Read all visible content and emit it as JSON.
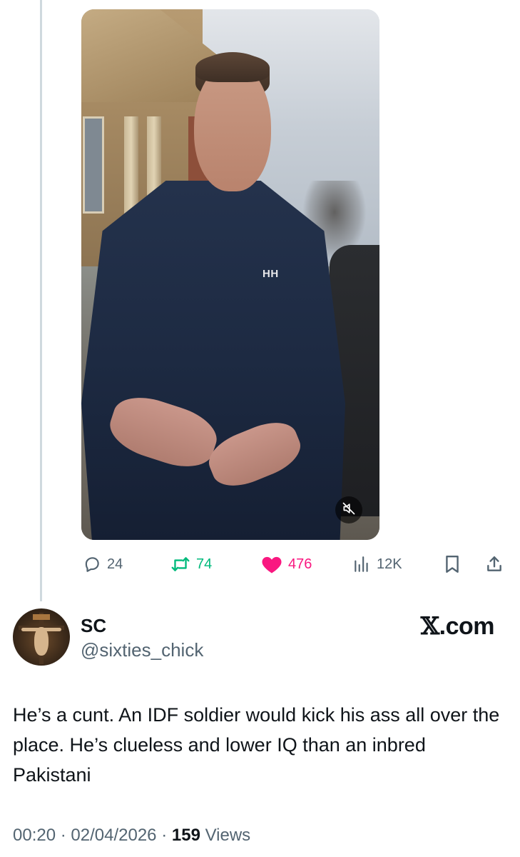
{
  "actions": {
    "replies": "24",
    "reposts": "74",
    "likes": "476",
    "views": "12K"
  },
  "video": {
    "jacket_logo": "HH",
    "muted": true
  },
  "author": {
    "name": "SC",
    "handle": "@sixties_chick"
  },
  "brand": {
    "x_glyph": "𝕏",
    "suffix": ".com"
  },
  "tweet": {
    "text": "He’s a cunt. An IDF soldier would kick his ass all over the place. He’s clueless and lower IQ than an inbred Pakistani"
  },
  "meta": {
    "time": "00:20",
    "date": "02/04/2026",
    "views_count": "159",
    "views_label": "Views",
    "separator": "·"
  },
  "colors": {
    "repost": "#00ba7c",
    "like": "#f91880",
    "muted_text": "#536471",
    "text": "#0f1419"
  },
  "icons": [
    "reply-icon",
    "repost-icon",
    "heart-icon",
    "views-icon",
    "bookmark-icon",
    "share-icon",
    "mute-icon"
  ]
}
